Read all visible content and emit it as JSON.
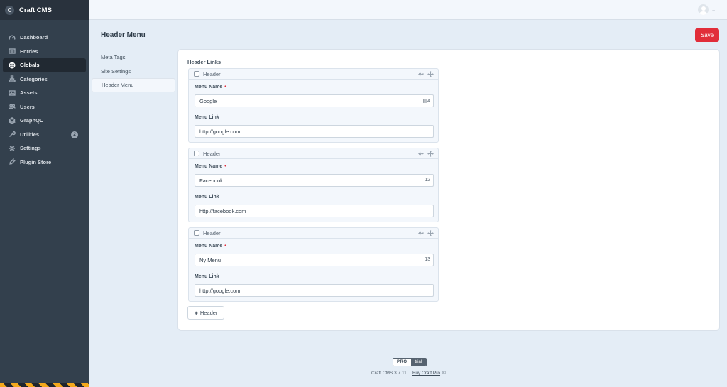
{
  "app": {
    "name": "Craft CMS",
    "logo_glyph": "C"
  },
  "sidebar": {
    "items": [
      {
        "label": "Dashboard",
        "icon": "gauge-icon"
      },
      {
        "label": "Entries",
        "icon": "newspaper-icon"
      },
      {
        "label": "Globals",
        "icon": "globe-icon",
        "active": true
      },
      {
        "label": "Categories",
        "icon": "sitemap-icon"
      },
      {
        "label": "Assets",
        "icon": "image-icon"
      },
      {
        "label": "Users",
        "icon": "users-icon"
      },
      {
        "label": "GraphQL",
        "icon": "graphql-icon"
      },
      {
        "label": "Utilities",
        "icon": "wrench-icon",
        "badge": "2"
      },
      {
        "label": "Settings",
        "icon": "gear-icon"
      },
      {
        "label": "Plugin Store",
        "icon": "plug-icon"
      }
    ]
  },
  "header": {
    "title": "Header Menu",
    "save_label": "Save"
  },
  "subnav": {
    "items": [
      "Meta Tags",
      "Site Settings",
      "Header Menu"
    ],
    "active_index": 2
  },
  "field": {
    "title": "Header Links",
    "block_type": "Header",
    "name_label": "Menu Name",
    "link_label": "Menu Link",
    "blocks": [
      {
        "name": "Google",
        "counter": "4",
        "link": "http://google.com"
      },
      {
        "name": "Facebook",
        "counter": "12",
        "link": "http://facebook.com"
      },
      {
        "name": "Ny Menu",
        "counter": "13",
        "link": "http://google.com"
      }
    ],
    "add_label": "Header"
  },
  "footer": {
    "edition_pro": "PRO",
    "edition_trial": "trial",
    "version": "Craft CMS 3.7.11",
    "buy_link": "Buy Craft Pro",
    "icon_glyph": "©"
  },
  "colors": {
    "accent": "#e12d39",
    "sidebar": "#33404d",
    "background": "#e4edf6"
  }
}
